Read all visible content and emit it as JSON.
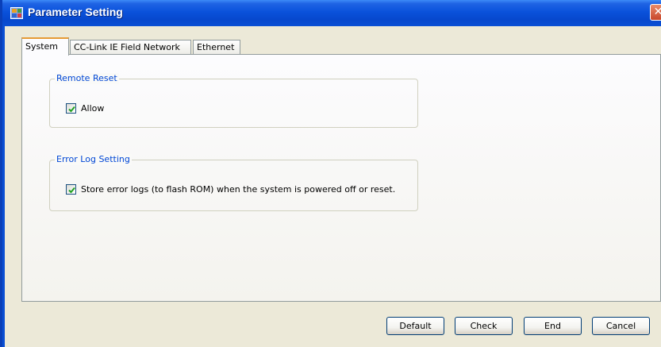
{
  "window": {
    "title": "Parameter Setting",
    "close_glyph": "✕"
  },
  "tabs": [
    {
      "label": "System",
      "active": true
    },
    {
      "label": "CC-Link IE Field Network",
      "active": false
    },
    {
      "label": "Ethernet",
      "active": false
    }
  ],
  "groups": {
    "remote_reset": {
      "title": "Remote Reset",
      "checkbox": {
        "label": "Allow",
        "checked": true
      }
    },
    "error_log": {
      "title": "Error Log Setting",
      "checkbox": {
        "label": "Store error logs (to flash ROM) when the system is powered off or reset.",
        "checked": true
      }
    }
  },
  "buttons": {
    "default": "Default",
    "check": "Check",
    "end": "End",
    "cancel": "Cancel"
  },
  "colors": {
    "titlebar": "#0a4fd4",
    "group_title": "#0046d5",
    "checkmark": "#21a121",
    "active_tab_accent": "#e69a35"
  },
  "icons": {
    "app": "parameter-setting-icon",
    "close": "close-icon",
    "check": "checkmark-icon"
  }
}
